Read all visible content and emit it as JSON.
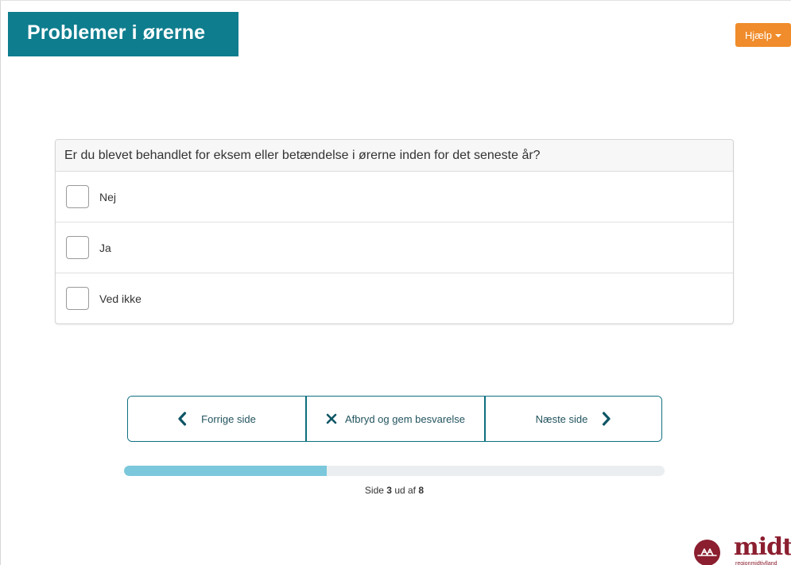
{
  "header": {
    "title": "Problemer i ørerne",
    "help_label": "Hjælp"
  },
  "question": {
    "text": "Er du blevet behandlet for eksem eller betændelse i ørerne inden for det seneste år?",
    "options": [
      {
        "label": "Nej",
        "checked": false
      },
      {
        "label": "Ja",
        "checked": false
      },
      {
        "label": "Ved ikke",
        "checked": false
      }
    ]
  },
  "navigation": {
    "prev_label": "Forrige side",
    "abort_label": "Afbryd og gem besvarelse",
    "next_label": "Næste side"
  },
  "progress": {
    "prefix": "Side",
    "current_page": "3",
    "middle": "ud af",
    "total_pages": "8",
    "fraction": 0.375
  },
  "logo": {
    "wordmark": "midt",
    "subtext": "regionmidtjylland"
  },
  "colors": {
    "primary": "#0e7d8e",
    "accent": "#f08c2b",
    "progress": "#7bc8dc",
    "brand": "#8b1e2f"
  }
}
